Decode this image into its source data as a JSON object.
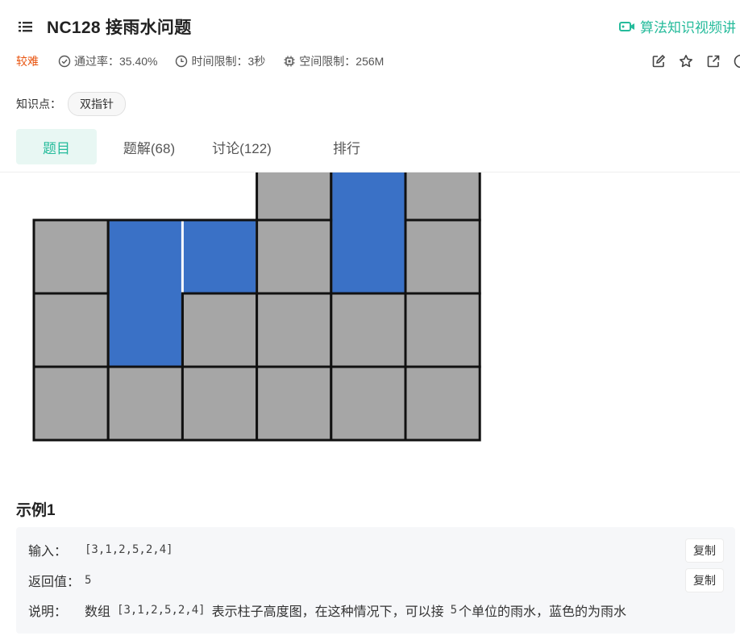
{
  "problem": {
    "title": "NC128  接雨水问题",
    "video_link": "算法知识视频讲",
    "difficulty": "较难",
    "pass_rate": "通过率：35.40%",
    "time_limit": "时间限制：3秒",
    "memory_limit": "空间限制：256M",
    "knowledge_label": "知识点：",
    "knowledge_tag": "双指针"
  },
  "icons": {
    "list": "list-icon",
    "video": "video-icon",
    "pass": "check-circle-icon",
    "time": "clock-icon",
    "memory": "chip-icon",
    "edit": "edit-icon",
    "favorite": "star-icon",
    "share": "external-link-icon",
    "info": "info-icon"
  },
  "tabs": [
    {
      "label": "题目",
      "active": true
    },
    {
      "label": "题解(68)",
      "active": false
    },
    {
      "label": "讨论(122)",
      "active": false
    },
    {
      "label": "排行",
      "active": false
    }
  ],
  "figure": {
    "heights": [
      3,
      1,
      2,
      5,
      2,
      4
    ],
    "water": [
      0,
      2,
      1,
      0,
      2,
      0
    ],
    "colors": {
      "bar": "#a6a6a6",
      "water": "#3a71c6",
      "border": "#111111"
    }
  },
  "example": {
    "title": "示例1",
    "input_label": "输入：",
    "input_value": "[3,1,2,5,2,4]",
    "output_label": "返回值：",
    "output_value": "5",
    "explain_label": "说明：",
    "explain_text_1": "数组",
    "explain_array": "[3,1,2,5,2,4]",
    "explain_text_2": "表示柱子高度图，在这种情况下，可以接",
    "explain_num": "5",
    "explain_text_3": "个单位的雨水，蓝色的为雨水",
    "copy_label": "复制"
  },
  "colors": {
    "accent": "#25bb9b",
    "difficulty": "#e8530e"
  }
}
